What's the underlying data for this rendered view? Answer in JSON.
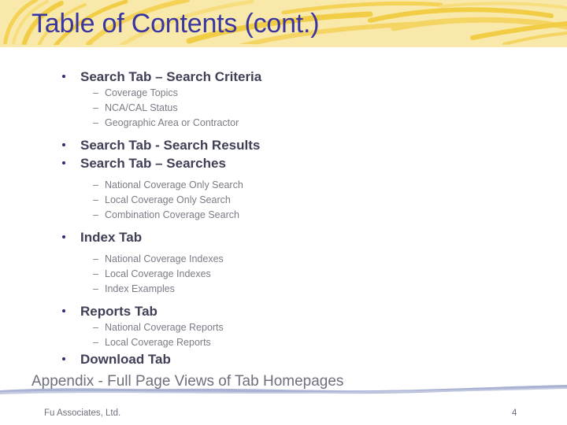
{
  "slide": {
    "title": "Table of Contents (cont.)",
    "page_number": "4",
    "footer_text": "Fu Associates, Ltd.",
    "appendix_line": "Appendix - Full Page Views of Tab Homepages",
    "colors": {
      "header_background": "#f8e9ab",
      "header_accent": "#f2d04c",
      "title_text": "#3a35a0",
      "bullet_dot": "#2b2b7a",
      "level1_text": "#3f3f56",
      "level2_text": "#7b7b87",
      "divider": "#aab2d4",
      "footer_text": "#6f6f7d",
      "body_background": "#ffffff"
    }
  },
  "outline": [
    {
      "label": "Search Tab – Search Criteria",
      "children": [
        "Coverage Topics",
        "NCA/CAL Status",
        "Geographic Area or Contractor"
      ]
    },
    {
      "label": "Search Tab - Search Results",
      "children": []
    },
    {
      "label": "Search Tab – Searches",
      "children": [
        "National Coverage Only Search",
        "Local Coverage Only Search",
        "Combination Coverage Search"
      ]
    },
    {
      "label": "Index Tab",
      "children": [
        "National Coverage Indexes",
        "Local Coverage Indexes",
        "Index Examples"
      ]
    },
    {
      "label": "Reports Tab",
      "children": [
        "National Coverage Reports",
        "Local Coverage Reports"
      ]
    },
    {
      "label": "Download Tab",
      "children": []
    }
  ],
  "icons": {
    "bullet": "bullet-dot-icon",
    "dash": "–"
  }
}
